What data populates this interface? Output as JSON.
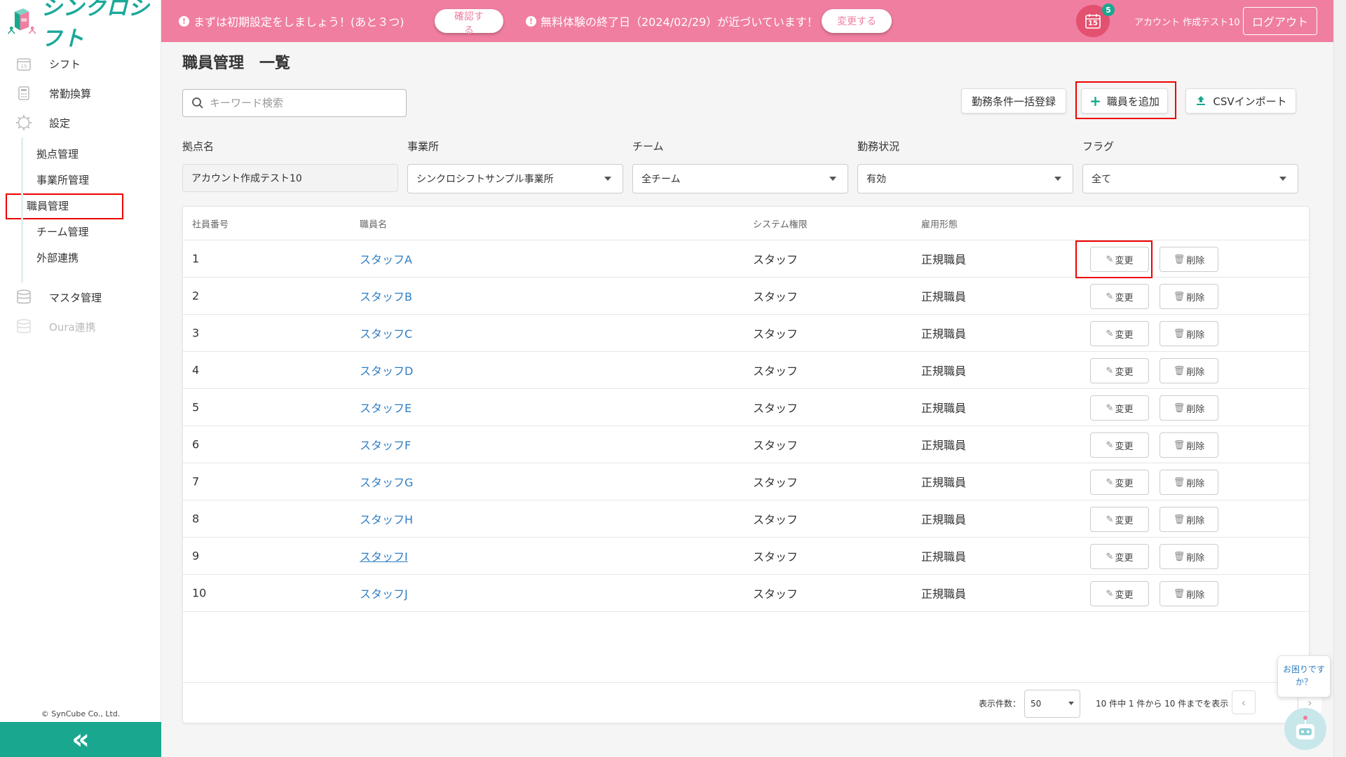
{
  "app": {
    "logo_text": "シンクロシフト"
  },
  "topbar": {
    "notice1": "まずは初期設定をしましょう！(あと３つ)",
    "confirm_label": "確認する",
    "notice2": "無料体験の終了日（2024/02/29）が近づいています！",
    "change_label": "変更する",
    "calendar_day": "15",
    "notification_count": "5",
    "account_name": "アカウント 作成テスト10",
    "logout_label": "ログアウト"
  },
  "sidebar": {
    "items": [
      {
        "label": "シフト",
        "icon": "calendar-icon"
      },
      {
        "label": "常勤換算",
        "icon": "calculator-icon"
      },
      {
        "label": "設定",
        "icon": "gear-icon"
      }
    ],
    "sub_items": [
      {
        "label": "拠点管理"
      },
      {
        "label": "事業所管理"
      },
      {
        "label": "職員管理"
      },
      {
        "label": "チーム管理"
      },
      {
        "label": "外部連携"
      }
    ],
    "bottom_items": [
      {
        "label": "マスタ管理",
        "icon": "database-icon"
      },
      {
        "label": "Oura連携",
        "icon": "database-icon"
      }
    ],
    "copyright": "© SynCube Co., Ltd.",
    "collapse_icon": "«"
  },
  "main": {
    "title": "職員管理　一覧",
    "search_placeholder": "キーワード検索",
    "buttons": {
      "bulk": "勤務条件一括登録",
      "add": "職員を追加",
      "csv": "CSVインポート"
    },
    "filters": {
      "base_label": "拠点名",
      "base_value": "アカウント作成テスト10",
      "office_label": "事業所",
      "office_value": "シンクロシフトサンプル事業所",
      "team_label": "チーム",
      "team_value": "全チーム",
      "status_label": "勤務状況",
      "status_value": "有効",
      "flag_label": "フラグ",
      "flag_value": "全て"
    },
    "table": {
      "headers": {
        "no": "社員番号",
        "name": "職員名",
        "role": "システム権限",
        "emp": "雇用形態"
      },
      "edit_label": "変更",
      "delete_label": "削除",
      "rows": [
        {
          "no": "1",
          "name": "スタッフA",
          "role": "スタッフ",
          "emp": "正規職員"
        },
        {
          "no": "2",
          "name": "スタッフB",
          "role": "スタッフ",
          "emp": "正規職員"
        },
        {
          "no": "3",
          "name": "スタッフC",
          "role": "スタッフ",
          "emp": "正規職員"
        },
        {
          "no": "4",
          "name": "スタッフD",
          "role": "スタッフ",
          "emp": "正規職員"
        },
        {
          "no": "5",
          "name": "スタッフE",
          "role": "スタッフ",
          "emp": "正規職員"
        },
        {
          "no": "6",
          "name": "スタッフF",
          "role": "スタッフ",
          "emp": "正規職員"
        },
        {
          "no": "7",
          "name": "スタッフG",
          "role": "スタッフ",
          "emp": "正規職員"
        },
        {
          "no": "8",
          "name": "スタッフH",
          "role": "スタッフ",
          "emp": "正規職員"
        },
        {
          "no": "9",
          "name": "スタッフI",
          "role": "スタッフ",
          "emp": "正規職員"
        },
        {
          "no": "10",
          "name": "スタッフJ",
          "role": "スタッフ",
          "emp": "正規職員"
        }
      ]
    },
    "pager": {
      "per_page_label": "表示件数：",
      "per_page_value": "50",
      "info": "10 件中 1 件から 10 件までを表示"
    }
  },
  "help": {
    "text": "お困りですか？"
  },
  "colors": {
    "brand": "#19a88f",
    "topbar": "#f07ea0",
    "link": "#2f7ec4",
    "highlight": "#ee0000"
  }
}
